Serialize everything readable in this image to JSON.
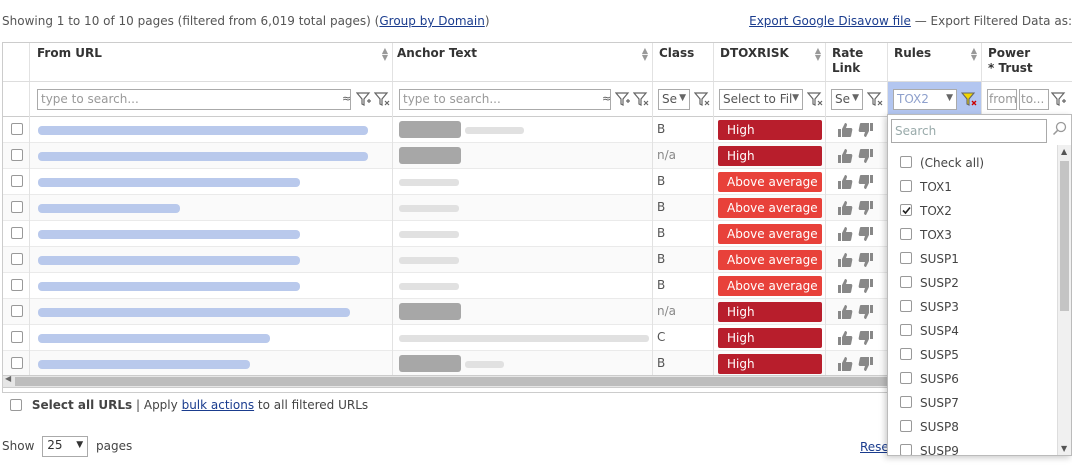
{
  "topbar": {
    "summary": "Showing 1 to 10 of 10 pages (filtered from 6,019 total pages)",
    "group_link": "Group by Domain",
    "export_disavow": "Export Google Disavow file",
    "export_filtered": "— Export Filtered Data as:"
  },
  "columns": {
    "from_url": "From URL",
    "anchor_text": "Anchor Text",
    "class": "Class",
    "dtoxrisk": "DTOXRISK",
    "rate_link_1": "Rate",
    "rate_link_2": "Link",
    "rules": "Rules",
    "power_trust_1": "Power",
    "power_trust_2": "* Trust"
  },
  "filters": {
    "from_url_placeholder": "type to search...",
    "anchor_placeholder": "type to search...",
    "class_value": "Se",
    "dtox_value": "Select to Fil",
    "rate_value": "Se",
    "rules_value": "TOX2",
    "power_from": "from",
    "power_to": "to..."
  },
  "rows": [
    {
      "class": "B",
      "risk": "High",
      "level": "high"
    },
    {
      "class": "n/a",
      "risk": "High",
      "level": "high"
    },
    {
      "class": "B",
      "risk": "Above average",
      "level": "above"
    },
    {
      "class": "B",
      "risk": "Above average",
      "level": "above"
    },
    {
      "class": "B",
      "risk": "Above average",
      "level": "above"
    },
    {
      "class": "B",
      "risk": "Above average",
      "level": "above"
    },
    {
      "class": "B",
      "risk": "Above average",
      "level": "above"
    },
    {
      "class": "n/a",
      "risk": "High",
      "level": "high"
    },
    {
      "class": "C",
      "risk": "High",
      "level": "high"
    },
    {
      "class": "B",
      "risk": "High",
      "level": "high"
    }
  ],
  "footer": {
    "select_all": "Select all URLs",
    "apply_prefix": "| Apply",
    "bulk_actions": "bulk actions",
    "apply_suffix": "to all filtered URLs",
    "show_label": "Show",
    "page_size": "25",
    "pages_label": "pages",
    "reset": "Rese"
  },
  "rules_popup": {
    "search_placeholder": "Search",
    "items": [
      {
        "label": "(Check all)",
        "checked": false
      },
      {
        "label": "TOX1",
        "checked": false
      },
      {
        "label": "TOX2",
        "checked": true
      },
      {
        "label": "TOX3",
        "checked": false
      },
      {
        "label": "SUSP1",
        "checked": false
      },
      {
        "label": "SUSP2",
        "checked": false
      },
      {
        "label": "SUSP3",
        "checked": false
      },
      {
        "label": "SUSP4",
        "checked": false
      },
      {
        "label": "SUSP5",
        "checked": false
      },
      {
        "label": "SUSP6",
        "checked": false
      },
      {
        "label": "SUSP7",
        "checked": false
      },
      {
        "label": "SUSP8",
        "checked": false
      },
      {
        "label": "SUSP9",
        "checked": false
      }
    ]
  },
  "colors": {
    "high": "#b81e2c",
    "above_average": "#e8413a",
    "link": "#1a3c8e",
    "active_filter": "#b3c6f0"
  }
}
